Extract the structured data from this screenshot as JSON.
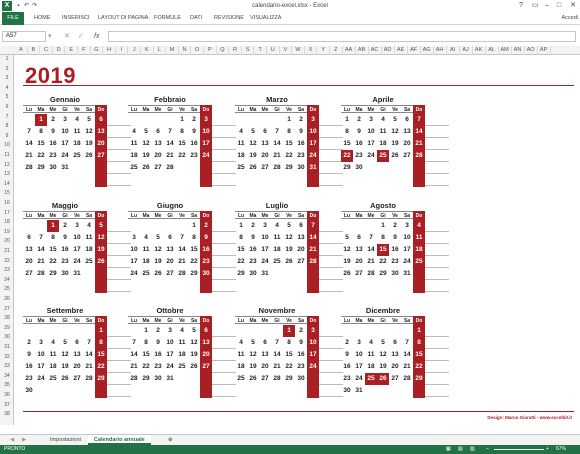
{
  "window": {
    "title": "calendario-excel.xlsx - Excel"
  },
  "ribbon": {
    "tabs": [
      "FILE",
      "HOME",
      "INSERISCI",
      "LAYOUT DI PAGINA",
      "FORMULE",
      "DATI",
      "REVISIONE",
      "VISUALIZZA"
    ],
    "account": "Accedi"
  },
  "formula_bar": {
    "name_box": "A57",
    "value": ""
  },
  "columns": [
    "A",
    "B",
    "C",
    "D",
    "E",
    "F",
    "G",
    "H",
    "I",
    "J",
    "K",
    "L",
    "M",
    "N",
    "O",
    "P",
    "Q",
    "R",
    "S",
    "T",
    "U",
    "V",
    "W",
    "X",
    "Y",
    "Z",
    "AA",
    "AB",
    "AC",
    "AD",
    "AE",
    "AF",
    "AG",
    "AH",
    "AI",
    "AJ",
    "AK",
    "AL",
    "AM",
    "AN",
    "AO",
    "AP"
  ],
  "rows": [
    "1",
    "2",
    "3",
    "4",
    "5",
    "6",
    "7",
    "8",
    "9",
    "10",
    "11",
    "12",
    "13",
    "14",
    "15",
    "16",
    "17",
    "18",
    "19",
    "20",
    "21",
    "22",
    "23",
    "24",
    "25",
    "26",
    "27",
    "28",
    "29",
    "30",
    "31",
    "32",
    "33",
    "34",
    "35",
    "36",
    "37",
    "38"
  ],
  "calendar": {
    "year": "2019",
    "weekdays": [
      "Lu",
      "Ma",
      "Me",
      "Gi",
      "Ve",
      "Sa",
      "Do"
    ],
    "credit": "Design: Marco Giuratti - www.excelbit.it",
    "months": [
      {
        "name": "Gennaio",
        "offset": 1,
        "days": 31,
        "holidays": [
          1,
          6
        ]
      },
      {
        "name": "Febbraio",
        "offset": 4,
        "days": 28,
        "holidays": []
      },
      {
        "name": "Marzo",
        "offset": 4,
        "days": 31,
        "holidays": []
      },
      {
        "name": "Aprile",
        "offset": 0,
        "days": 30,
        "holidays": [
          22,
          25
        ]
      },
      {
        "name": "Maggio",
        "offset": 2,
        "days": 31,
        "holidays": [
          1
        ]
      },
      {
        "name": "Giugno",
        "offset": 5,
        "days": 30,
        "holidays": [
          2
        ]
      },
      {
        "name": "Luglio",
        "offset": 0,
        "days": 31,
        "holidays": []
      },
      {
        "name": "Agosto",
        "offset": 3,
        "days": 31,
        "holidays": [
          15
        ]
      },
      {
        "name": "Settembre",
        "offset": 6,
        "days": 30,
        "holidays": []
      },
      {
        "name": "Ottobre",
        "offset": 1,
        "days": 31,
        "holidays": []
      },
      {
        "name": "Novembre",
        "offset": 4,
        "days": 30,
        "holidays": [
          1
        ]
      },
      {
        "name": "Dicembre",
        "offset": 6,
        "days": 31,
        "holidays": [
          8,
          25,
          26
        ]
      }
    ]
  },
  "sheet_tabs": [
    "Impostazioni",
    "Calendario annuale"
  ],
  "status": {
    "ready": "PRONTO",
    "zoom": "67%"
  }
}
